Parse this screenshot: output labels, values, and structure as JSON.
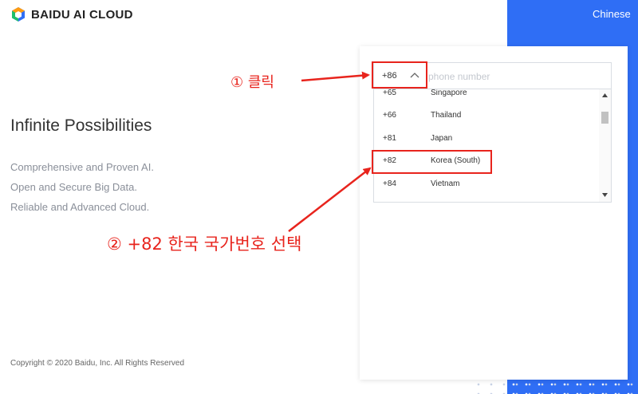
{
  "header": {
    "brand": "BAIDU AI CLOUD",
    "language_link": "Chinese"
  },
  "hero": {
    "headline": "Infinite Possibilities",
    "taglines": [
      "Comprehensive and Proven AI.",
      "Open and Secure Big Data.",
      "Reliable and Advanced Cloud."
    ]
  },
  "footer": {
    "copyright": "Copyright © 2020 Baidu, Inc. All Rights Reserved"
  },
  "login_form": {
    "country_code": "+86",
    "phone_placeholder": "phone number",
    "phone_value": "",
    "country_options": [
      {
        "code": "+65",
        "name": "Singapore"
      },
      {
        "code": "+66",
        "name": "Thailand"
      },
      {
        "code": "+81",
        "name": "Japan"
      },
      {
        "code": "+82",
        "name": "Korea (South)"
      },
      {
        "code": "+84",
        "name": "Vietnam"
      }
    ]
  },
  "annotations": {
    "step1": "① 클릭",
    "step2": "② +82 한국 국가번호 선택"
  },
  "colors": {
    "accent_blue": "#2f6ef5",
    "annotation_red": "#e8241d"
  },
  "icons": {
    "logo": "baidu-cloud-logo-icon",
    "chevron": "chevron-up-icon",
    "scroll_up": "scroll-up-arrow-icon",
    "scroll_down": "scroll-down-arrow-icon"
  }
}
